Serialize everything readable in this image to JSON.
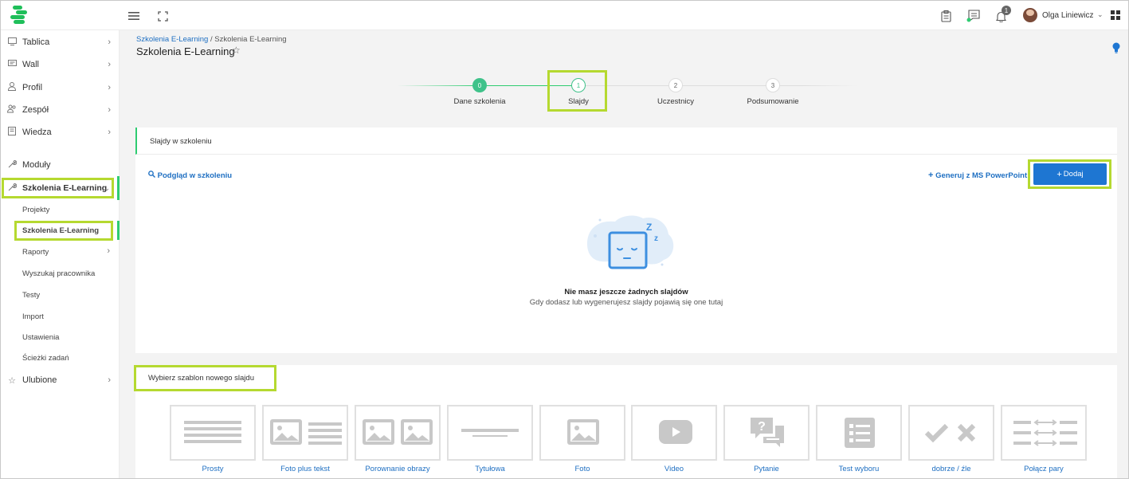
{
  "header": {
    "menu_icon": "hamburger-icon",
    "fullscreen_icon": "expand-icon",
    "notification_count": "1",
    "user_name": "Olga Liniewicz"
  },
  "sidebar": {
    "items": [
      {
        "label": "Tablica",
        "icon": "monitor-icon"
      },
      {
        "label": "Wall",
        "icon": "chat-icon"
      },
      {
        "label": "Profil",
        "icon": "user-icon"
      },
      {
        "label": "Zespół",
        "icon": "team-icon"
      },
      {
        "label": "Wiedza",
        "icon": "book-icon"
      },
      {
        "label": "Moduły",
        "icon": "wrench-icon"
      },
      {
        "label": "Szkolenia E-Learning",
        "icon": "wrench-icon"
      },
      {
        "label": "Ulubione",
        "icon": "star-icon"
      }
    ],
    "sub_items": [
      {
        "label": "Projekty"
      },
      {
        "label": "Szkolenia E-Learning"
      },
      {
        "label": "Raporty"
      },
      {
        "label": "Wyszukaj pracownika"
      },
      {
        "label": "Testy"
      },
      {
        "label": "Import"
      },
      {
        "label": "Ustawienia"
      },
      {
        "label": "Ścieżki zadań"
      }
    ]
  },
  "breadcrumb": {
    "link": "Szkolenia E-Learning",
    "separator": " / ",
    "current": "Szkolenia E-Learning"
  },
  "page_title": "Szkolenia E-Learning",
  "stepper": {
    "steps": [
      {
        "number": "0",
        "label": "Dane szkolenia",
        "state": "done"
      },
      {
        "number": "1",
        "label": "Slajdy",
        "state": "active"
      },
      {
        "number": "2",
        "label": "Uczestnicy",
        "state": "pending"
      },
      {
        "number": "3",
        "label": "Podsumowanie",
        "state": "pending"
      }
    ]
  },
  "slides_card": {
    "title": "Slajdy w szkoleniu",
    "preview_link": "Podgląd w szkoleniu",
    "generate_link": "Generuj z MS PowerPoint",
    "add_button": "Dodaj",
    "empty_title": "Nie masz jeszcze żadnych slajdów",
    "empty_subtitle": "Gdy dodasz lub wygenerujesz slajdy pojawią się one tutaj",
    "empty_z_big": "Z",
    "empty_z_small": "z"
  },
  "templates_card": {
    "title": "Wybierz szablon nowego slajdu",
    "templates": [
      {
        "label": "Prosty"
      },
      {
        "label": "Foto plus tekst"
      },
      {
        "label": "Porownanie obrazy"
      },
      {
        "label": "Tytułowa"
      },
      {
        "label": "Foto"
      },
      {
        "label": "Video"
      },
      {
        "label": "Pytanie"
      },
      {
        "label": "Test wyboru"
      },
      {
        "label": "dobrze / źle"
      },
      {
        "label": "Połącz pary"
      }
    ]
  },
  "colors": {
    "accent_green": "#2ecc71",
    "highlight": "#b5d930",
    "link_blue": "#1e6fc2",
    "button_blue": "#1e76d2"
  }
}
